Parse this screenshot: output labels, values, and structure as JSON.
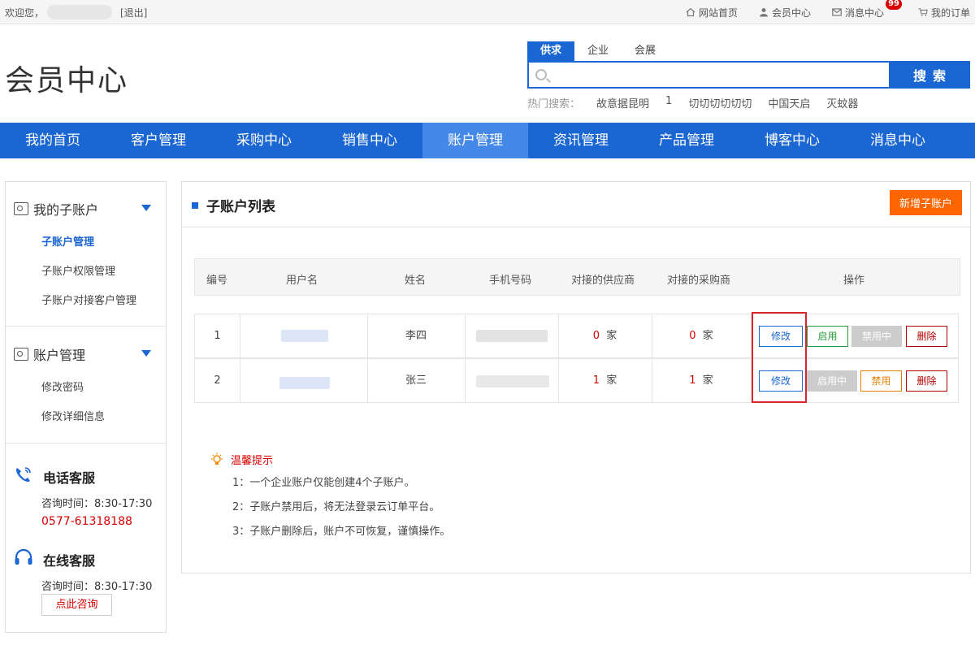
{
  "topbar": {
    "welcome": "欢迎您，",
    "logout": "[退出]",
    "links": [
      {
        "label": "网站首页",
        "icon": "home-icon"
      },
      {
        "label": "会员中心",
        "icon": "user-icon"
      },
      {
        "label": "消息中心",
        "icon": "mail-icon",
        "badge": "99"
      },
      {
        "label": "我的订单",
        "icon": "cart-icon"
      }
    ]
  },
  "header": {
    "logo": "会员中心",
    "search": {
      "tabs": [
        "供求",
        "企业",
        "会展"
      ],
      "active_tab": 0,
      "placeholder": "",
      "button": "搜索",
      "hot_label": "热门搜索：",
      "hot_words": [
        "故意据昆明",
        "1",
        "切切切切切切",
        "中国天启",
        "灭蚊器"
      ]
    }
  },
  "nav": {
    "items": [
      "我的首页",
      "客户管理",
      "采购中心",
      "销售中心",
      "账户管理",
      "资讯管理",
      "产品管理",
      "博客中心",
      "消息中心"
    ],
    "active": 4
  },
  "sidebar": {
    "groups": [
      {
        "title": "我的子账户",
        "items": [
          "子账户管理",
          "子账户权限管理",
          "子账户对接客户管理"
        ],
        "active": 0
      },
      {
        "title": "账户管理",
        "items": [
          "修改密码",
          "修改详细信息"
        ]
      }
    ],
    "phone_service": {
      "title": "电话客服",
      "hours": "咨询时间：8:30-17:30",
      "phone": "0577-61318188"
    },
    "online_service": {
      "title": "在线客服",
      "hours": "咨询时间：8:30-17:30",
      "button": "点此咨询"
    }
  },
  "main": {
    "title": "子账户列表",
    "add_button": "新增子账户",
    "columns": [
      "编号",
      "用户名",
      "姓名",
      "手机号码",
      "对接的供应商",
      "对接的采购商",
      "操作"
    ],
    "rows": [
      {
        "id": "1",
        "name": "李四",
        "suppliers": "0",
        "buyers": "0",
        "unit": "家",
        "toggle_enabled": true,
        "status_enable_label": "启用",
        "status_disable_label": "禁用中"
      },
      {
        "id": "2",
        "name": "张三",
        "suppliers": "1",
        "buyers": "1",
        "unit": "家",
        "toggle_enabled": false,
        "status_enable_label": "启用中",
        "status_disable_label": "禁用"
      }
    ],
    "edit_label": "修改",
    "delete_label": "删除",
    "tips": {
      "title": "温馨提示",
      "lines": [
        "1：一个企业账户仅能创建4个子账户。",
        "2：子账户禁用后，将无法登录云订单平台。",
        "3：子账户删除后，账户不可恢复，谨慎操作。"
      ]
    }
  }
}
